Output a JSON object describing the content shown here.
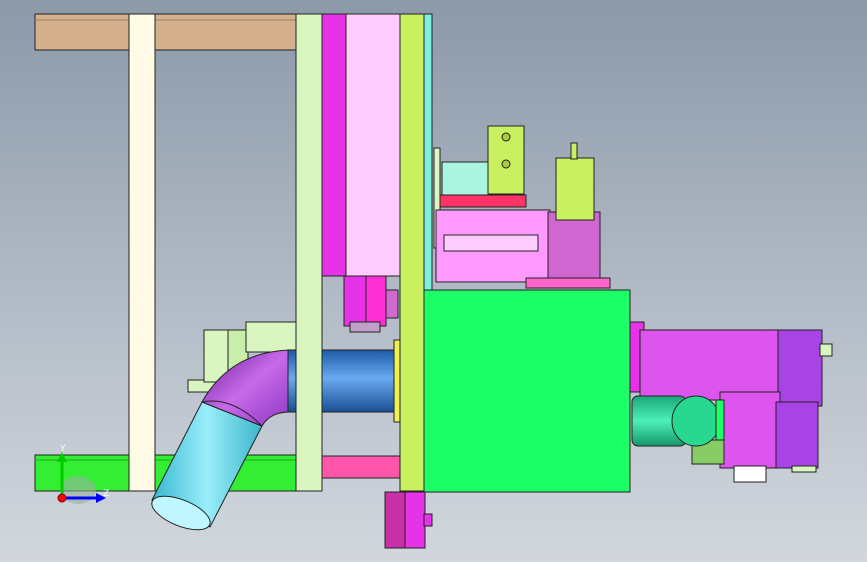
{
  "triad": {
    "y_label": "Y",
    "z_label": "Z",
    "colors": {
      "y": "#00cc00",
      "z": "#0000ff",
      "origin": "#ff0000"
    }
  },
  "palette": {
    "wood": "#d4b08e",
    "frame": "#fffbe6",
    "pale_green": "#d9f5c0",
    "magenta": "#e733e7",
    "pink": "#ffccff",
    "green": "#1cff66",
    "purple": "#a855e6",
    "blue_pipe": "#3d85d6",
    "cyan_pipe": "#66ddee",
    "hot_pink": "#ff55aa"
  }
}
